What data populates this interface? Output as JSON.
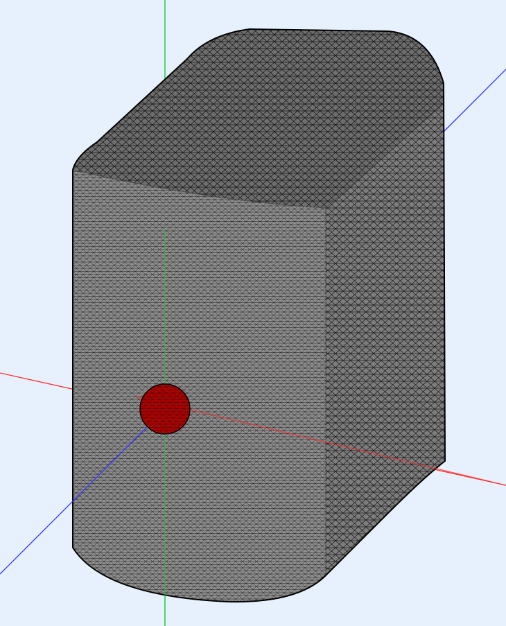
{
  "scene": {
    "background": "#e6f1fd",
    "object_type": "triangulated-surface-mesh",
    "body": {
      "shape": "rounded-rectangular-prism",
      "face_color": "#8c8c8c",
      "top_face_color": "#6e6e6e",
      "front_face_color": "#909090",
      "side_face_color": "#7d7d7d",
      "edge_color": "#000000"
    },
    "marker": {
      "shape": "disc",
      "face_color": "#b30000",
      "edge_color": "#000000"
    },
    "axes": [
      {
        "name": "x-axis",
        "color": "#ff2a2a"
      },
      {
        "name": "y-axis",
        "color": "#22cc44"
      },
      {
        "name": "z-axis",
        "color": "#3333ff"
      }
    ]
  }
}
